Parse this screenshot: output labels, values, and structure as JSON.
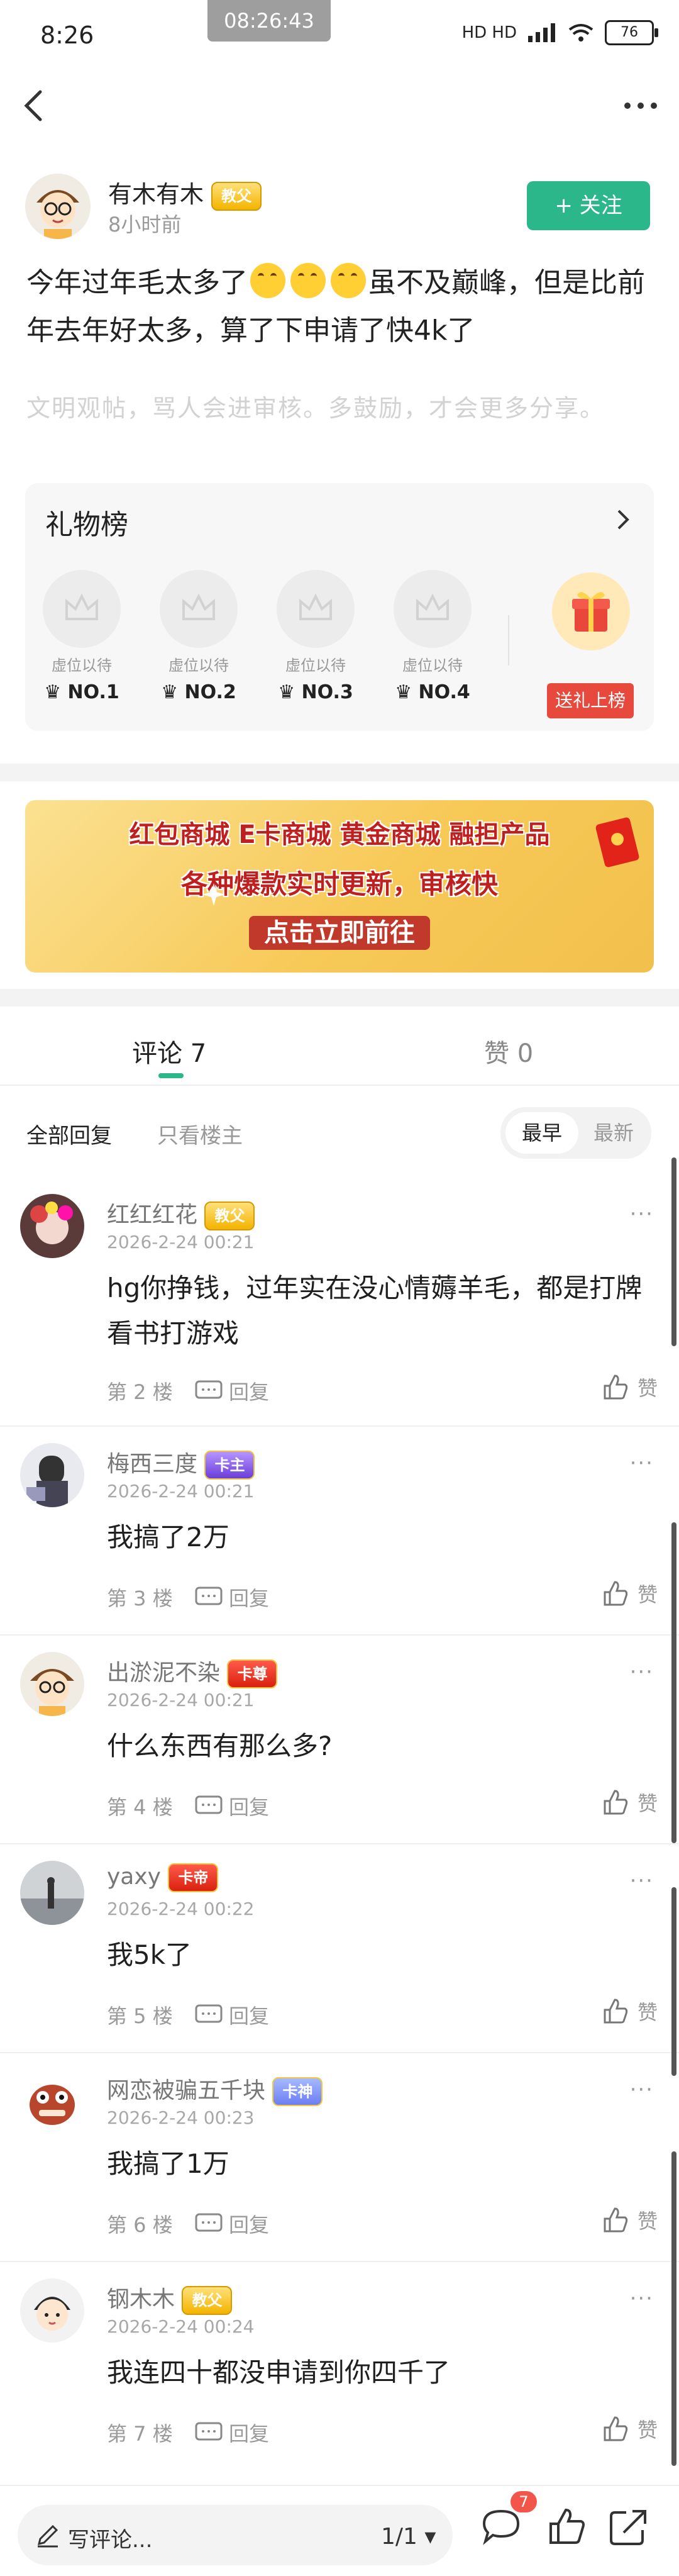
{
  "status_bar": {
    "time": "8:26",
    "recording_time": "08:26:43",
    "network": "HD HD",
    "battery": "76"
  },
  "post": {
    "author": {
      "name": "有木有木",
      "badge": "教父",
      "time": "8小时前"
    },
    "follow_label": "+ 关注",
    "text_part1": "今年过年毛太多了",
    "text_part2": "虽不及巅峰，但是比前年去年好太多，算了下申请了快4k了",
    "hint": "文明观帖，骂人会进审核。多鼓励，才会更多分享。"
  },
  "gift_board": {
    "title": "礼物榜",
    "slots": [
      {
        "label": "虚位以待",
        "rank": "NO.1"
      },
      {
        "label": "虚位以待",
        "rank": "NO.2"
      },
      {
        "label": "虚位以待",
        "rank": "NO.3"
      },
      {
        "label": "虚位以待",
        "rank": "NO.4"
      }
    ],
    "send_label": "送礼上榜"
  },
  "banner": {
    "line1": "红包商城   E卡商城   黄金商城   融担产品",
    "line2": "各种爆款实时更新，审核快",
    "line3": "点击立即前往"
  },
  "tabs": {
    "comments": "评论 7",
    "likes": "赞 0"
  },
  "filters": {
    "all": "全部回复",
    "op_only": "只看楼主",
    "earliest": "最早",
    "latest": "最新"
  },
  "comments": [
    {
      "name": "红红红花",
      "badge": "教父",
      "date": "2026-2-24 00:21",
      "text": "hg你挣钱，过年实在没心情薅羊毛，都是打牌看书打游戏",
      "floor": "第 2 楼",
      "reply": "回复",
      "like": "赞"
    },
    {
      "name": "梅西三度",
      "badge": "卡主",
      "date": "2026-2-24 00:21",
      "text": "我搞了2万",
      "floor": "第 3 楼",
      "reply": "回复",
      "like": "赞"
    },
    {
      "name": "出淤泥不染",
      "badge": "卡尊",
      "date": "2026-2-24 00:21",
      "text": "什么东西有那么多?",
      "floor": "第 4 楼",
      "reply": "回复",
      "like": "赞"
    },
    {
      "name": "yaxy",
      "badge": "卡帝",
      "date": "2026-2-24 00:22",
      "text": "我5k了",
      "floor": "第 5 楼",
      "reply": "回复",
      "like": "赞"
    },
    {
      "name": "网恋被骗五千块",
      "badge": "卡神",
      "date": "2026-2-24 00:23",
      "text": "我搞了1万",
      "floor": "第 6 楼",
      "reply": "回复",
      "like": "赞"
    },
    {
      "name": "钢木木",
      "badge": "教父",
      "date": "2026-2-24 00:24",
      "text": "我连四十都没申请到你四千了",
      "floor": "第 7 楼",
      "reply": "回复",
      "like": "赞"
    }
  ],
  "bottom_bar": {
    "write_placeholder": "写评论...",
    "page_indicator": "1/1",
    "notification_count": "7"
  }
}
